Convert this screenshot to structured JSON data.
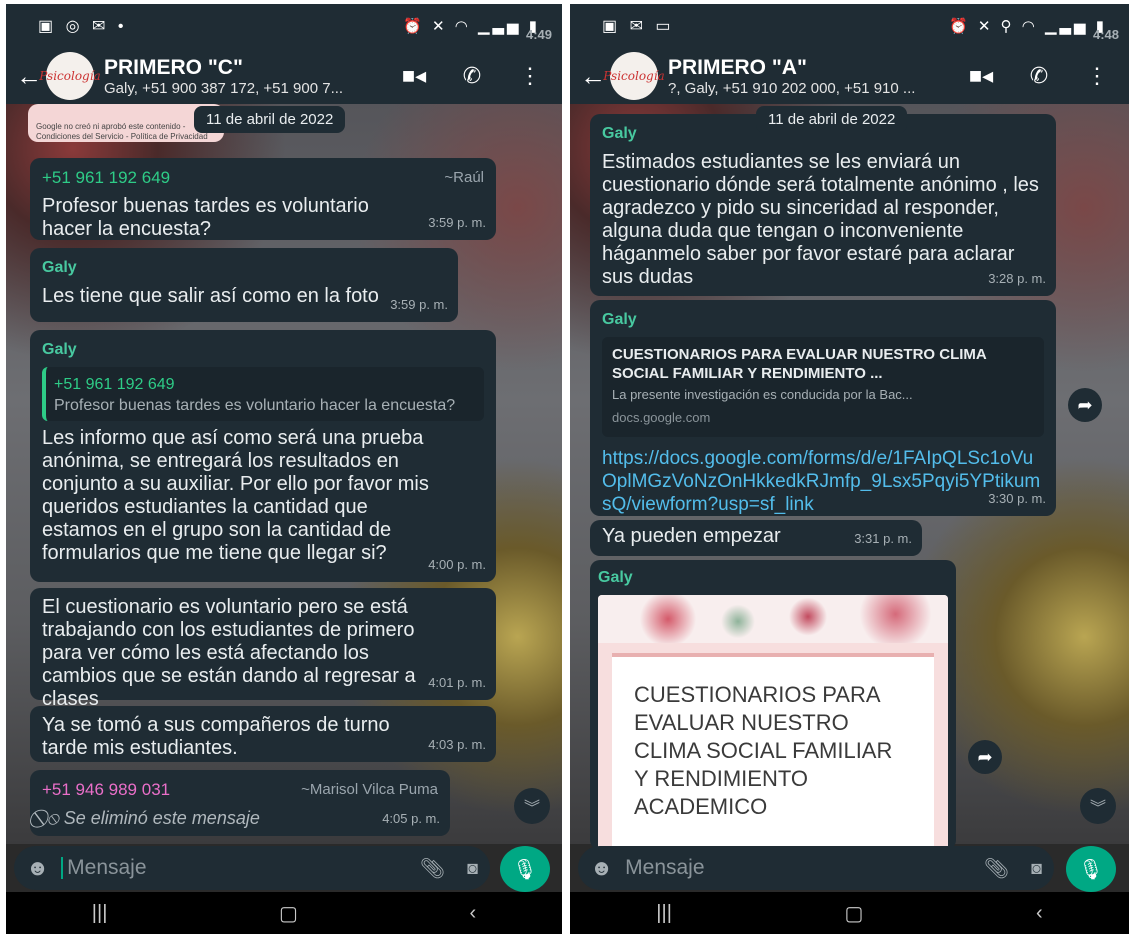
{
  "left": {
    "status_time": "4:49",
    "title": "PRIMERO \"C\"",
    "participants": "Galy, +51 900 387 172, +51 900 7...",
    "avatar_text": "Psicología",
    "preview_caption": "Google no creó ni aprobó este contenido - Condiciones del Servicio - Política de Privacidad",
    "date_chip": "11 de abril de 2022",
    "messages": [
      {
        "sender": "+51 961 192 649",
        "alias": "~Raúl",
        "text": "Profesor buenas tardes es voluntario hacer la encuesta?",
        "time": "3:59 p. m."
      },
      {
        "sender": "Galy",
        "text": "Les tiene que salir así como en la foto",
        "time": "3:59 p. m."
      },
      {
        "sender": "Galy",
        "quote_sender": "+51 961 192 649",
        "quote_text": "Profesor buenas tardes es voluntario hacer la encuesta?",
        "text": "Les informo que así como será una prueba anónima, se entregará los resultados en conjunto a su auxiliar. Por ello por favor mis  queridos estudiantes la cantidad que estamos en el grupo son la cantidad de formularios que me tiene que llegar si?",
        "time": "4:00 p. m."
      },
      {
        "text": "El cuestionario es voluntario pero se está trabajando con los estudiantes de primero para ver cómo les está afectando los cambios que se están dando al regresar a clases",
        "time": "4:01 p. m."
      },
      {
        "text": "Ya se tomó a sus compañeros de turno tarde mis estudiantes.",
        "time": "4:03 p. m."
      },
      {
        "sender": "+51 946 989 031",
        "alias": "~Marisol Vilca Puma",
        "text": "Se eliminó este mensaje",
        "time": "4:05 p. m."
      }
    ],
    "input_placeholder": "Mensaje"
  },
  "right": {
    "status_time": "4:48",
    "title": "PRIMERO  \"A\"",
    "participants": "?, Galy, +51 910 202 000, +51 910 ...",
    "avatar_text": "Psicología",
    "date_chip": "11 de abril de 2022",
    "messages": [
      {
        "sender": "Galy",
        "text": "Estimados estudiantes se les enviará un cuestionario dónde será totalmente anónimo , les agradezco y pido su sinceridad al responder, alguna duda que tengan o inconveniente háganmelo saber por favor estaré para aclarar sus dudas",
        "time": "3:28 p. m."
      },
      {
        "sender": "Galy",
        "link_title": "CUESTIONARIOS PARA EVALUAR NUESTRO CLIMA SOCIAL FAMILIAR Y RENDIMIENTO ...",
        "link_desc": "La presente investigación es conducida por la Bac...",
        "link_domain": "docs.google.com",
        "text": "https://docs.google.com/forms/d/e/1FAIpQLSc1oVuOplMGzVoNzOnHkkedkRJmfp_9Lsx5Pqyi5YPtikumsQ/viewform?usp=sf_link",
        "time": "3:30 p. m."
      },
      {
        "text": "Ya pueden empezar",
        "time": "3:31 p. m."
      },
      {
        "sender": "Galy",
        "image_text": "CUESTIONARIOS PARA EVALUAR NUESTRO CLIMA SOCIAL FAMILIAR Y RENDIMIENTO ACADEMICO"
      }
    ],
    "input_placeholder": "Mensaje"
  }
}
